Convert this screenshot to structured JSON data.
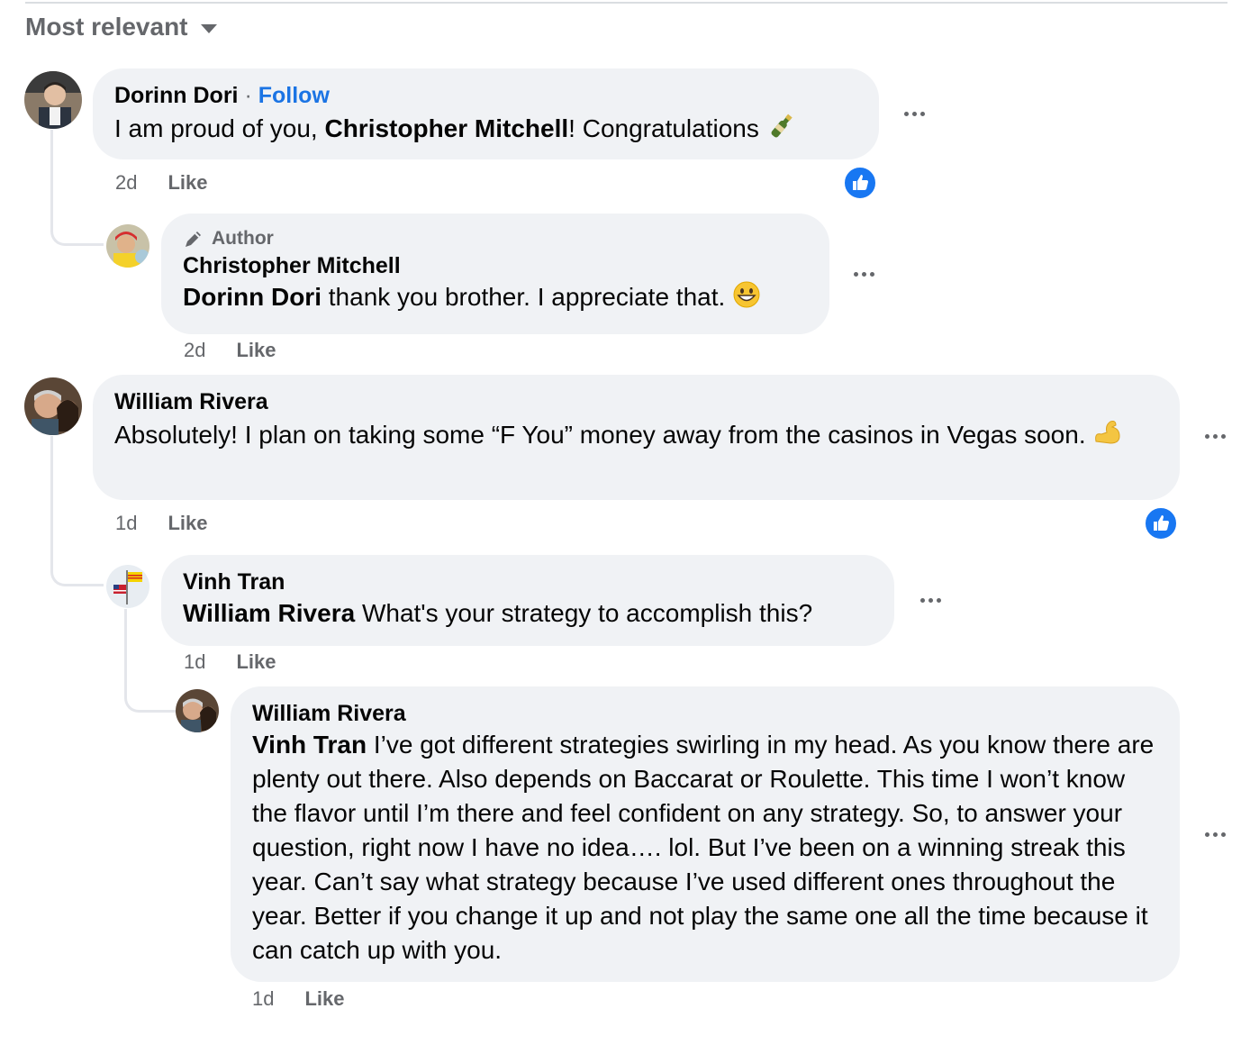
{
  "sort": {
    "label": "Most relevant"
  },
  "colors": {
    "bubble": "#f0f2f5",
    "link": "#1b74e4",
    "meta": "#65676b",
    "reaction": "#1877f2"
  },
  "comments": [
    {
      "author": "Dorinn Dori",
      "separator": "·",
      "follow": "Follow",
      "mention": "",
      "text_before": "I am proud of you, ",
      "text_bold": "Christopher Mitchell",
      "text_after": "! Congratulations",
      "emoji": "champagne-icon",
      "time": "2d",
      "like": "Like",
      "reaction": "like-icon"
    },
    {
      "badge": "Author",
      "author": "Christopher Mitchell",
      "mention": "Dorinn Dori",
      "text": " thank you brother. I appreciate that.",
      "emoji": "grinning-face-icon",
      "time": "2d",
      "like": "Like"
    },
    {
      "author": "William Rivera",
      "text": "Absolutely! I plan on taking some “F You” money away from the casinos in Vegas soon.",
      "emoji": "flexed-biceps-icon",
      "time": "1d",
      "like": "Like",
      "reaction": "like-icon"
    },
    {
      "author": "Vinh Tran",
      "mention": "William Rivera",
      "text": " What's your strategy to accomplish this?",
      "time": "1d",
      "like": "Like"
    },
    {
      "author": "William Rivera",
      "mention": "Vinh Tran",
      "text": " I’ve got different strategies swirling in my head. As you know there are plenty out there. Also depends on Baccarat or Roulette. This time I won’t know the flavor until I’m there and feel confident on any strategy. So, to answer your question, right now I have no idea…. lol. But I’ve been on a winning streak this year. Can’t say what strategy because I’ve used different ones throughout the year. Better if you change it up and not play the same one all the time because it can catch up with you.",
      "time": "1d",
      "like": "Like"
    }
  ]
}
